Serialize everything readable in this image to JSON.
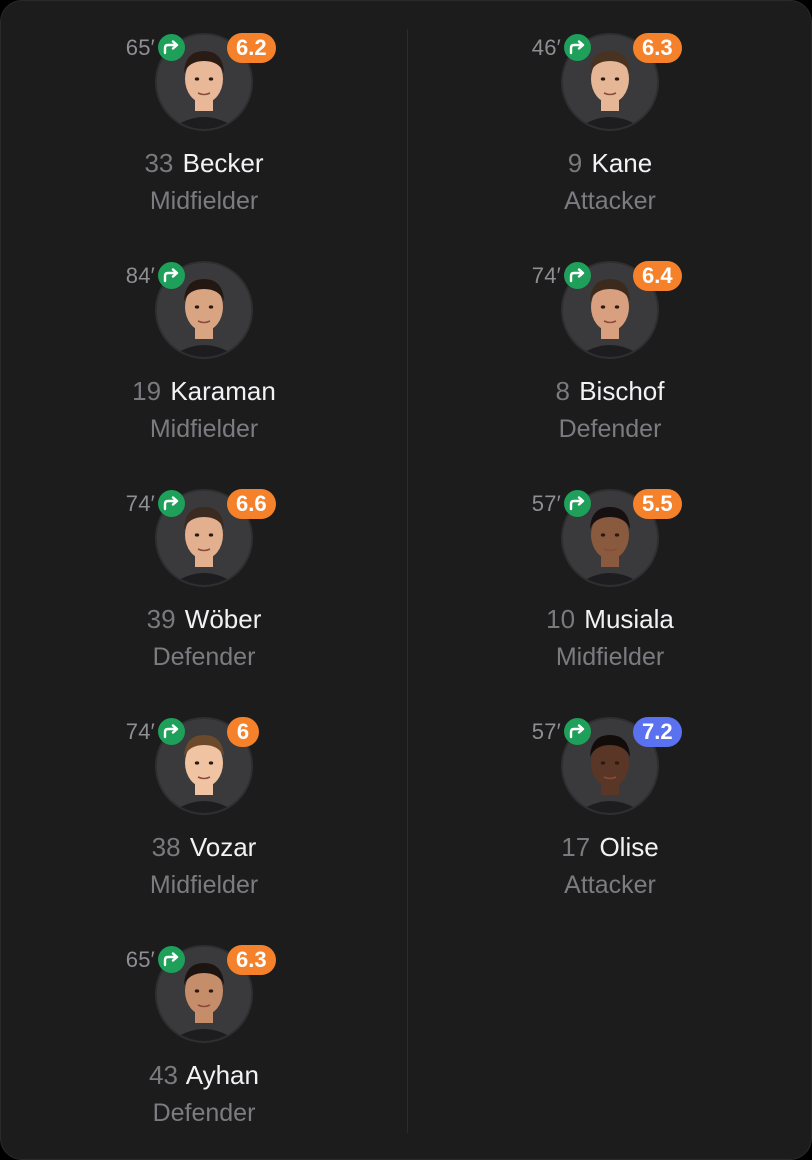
{
  "colors": {
    "rating_orange": "#f6812b",
    "rating_blue": "#5a72f0",
    "sub_green": "#1fa05a"
  },
  "left": [
    {
      "minute": "65′",
      "rating": "6.2",
      "rating_color": "orange",
      "number": "33",
      "name": "Becker",
      "position": "Midfielder"
    },
    {
      "minute": "84′",
      "rating": "",
      "rating_color": "",
      "number": "19",
      "name": "Karaman",
      "position": "Midfielder"
    },
    {
      "minute": "74′",
      "rating": "6.6",
      "rating_color": "orange",
      "number": "39",
      "name": "Wöber",
      "position": "Defender"
    },
    {
      "minute": "74′",
      "rating": "6",
      "rating_color": "orange",
      "number": "38",
      "name": "Vozar",
      "position": "Midfielder"
    },
    {
      "minute": "65′",
      "rating": "6.3",
      "rating_color": "orange",
      "number": "43",
      "name": "Ayhan",
      "position": "Defender"
    }
  ],
  "right": [
    {
      "minute": "46′",
      "rating": "6.3",
      "rating_color": "orange",
      "number": "9",
      "name": "Kane",
      "position": "Attacker"
    },
    {
      "minute": "74′",
      "rating": "6.4",
      "rating_color": "orange",
      "number": "8",
      "name": "Bischof",
      "position": "Defender"
    },
    {
      "minute": "57′",
      "rating": "5.5",
      "rating_color": "orange",
      "number": "10",
      "name": "Musiala",
      "position": "Midfielder"
    },
    {
      "minute": "57′",
      "rating": "7.2",
      "rating_color": "blue",
      "number": "17",
      "name": "Olise",
      "position": "Attacker"
    }
  ]
}
